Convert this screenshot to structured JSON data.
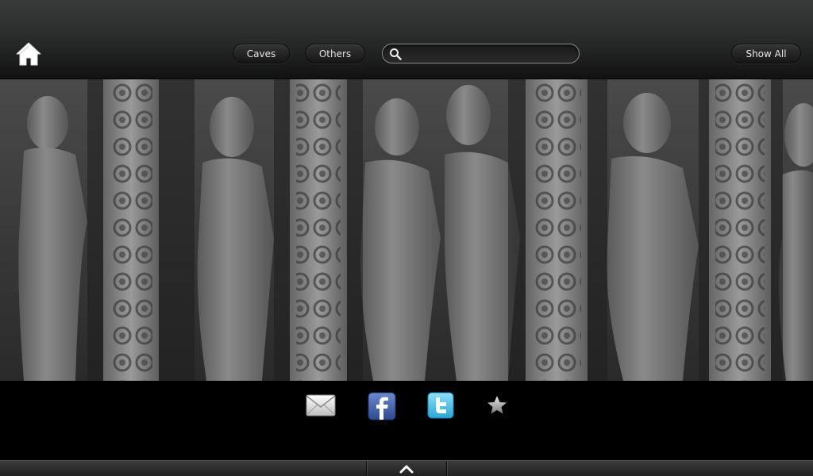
{
  "topbar": {
    "home_icon": "home-icon",
    "caves_label": "Caves",
    "others_label": "Others",
    "show_all_label": "Show All",
    "search": {
      "icon": "search-icon",
      "value": "",
      "placeholder": ""
    }
  },
  "main": {
    "image": "cave-relief-carving-photo"
  },
  "share": {
    "items": [
      {
        "icon": "mail-icon"
      },
      {
        "icon": "facebook-icon"
      },
      {
        "icon": "twitter-icon"
      },
      {
        "icon": "star-icon"
      }
    ]
  },
  "bottombar": {
    "icon": "chevron-up-icon"
  },
  "colors": {
    "topbar_top": "#3a3b3b",
    "topbar_bottom": "#121212",
    "stone": "#6b6b6b",
    "facebook": "#3b5998",
    "twitter": "#3fb7e3",
    "text": "#e6e6e6"
  }
}
